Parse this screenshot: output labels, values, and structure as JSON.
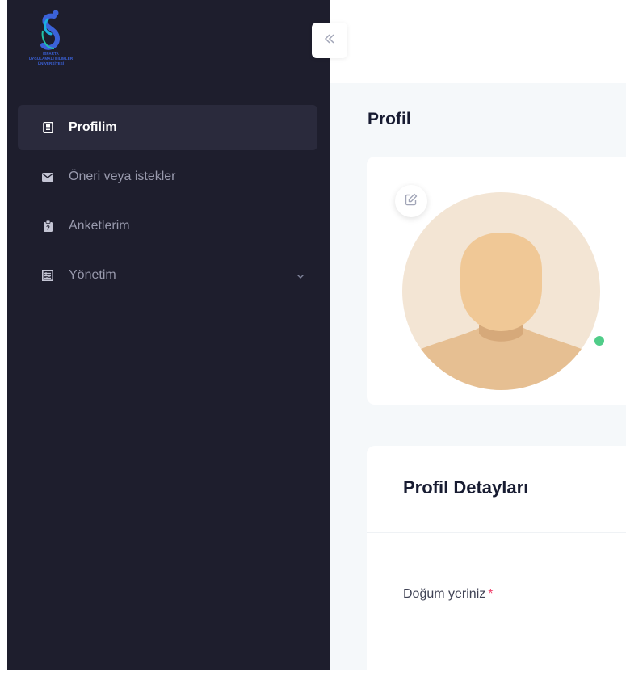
{
  "logo": {
    "lines": [
      "ISPARTA",
      "UYGULAMALI BİLİMLER",
      "ÜNİVERSİTESİ"
    ]
  },
  "sidebar": {
    "items": [
      {
        "label": "Profilim",
        "icon": "profile-badge-icon",
        "active": true
      },
      {
        "label": "Öneri veya istekler",
        "icon": "envelope-icon",
        "active": false
      },
      {
        "label": "Anketlerim",
        "icon": "survey-clipboard-icon",
        "active": false
      },
      {
        "label": "Yönetim",
        "icon": "management-icon",
        "active": false,
        "expandable": true
      }
    ]
  },
  "header": {
    "collapse_icon": "double-chevron-left-icon"
  },
  "page": {
    "title": "Profil"
  },
  "profile": {
    "status": "online",
    "status_color": "#50cd89"
  },
  "details": {
    "title": "Profil Detayları",
    "fields": [
      {
        "label": "Doğum yeriniz",
        "required": "*"
      }
    ]
  },
  "colors": {
    "sidebar_bg": "#1e1e2d",
    "accent": "#3b62d9",
    "required": "#f1416c"
  }
}
